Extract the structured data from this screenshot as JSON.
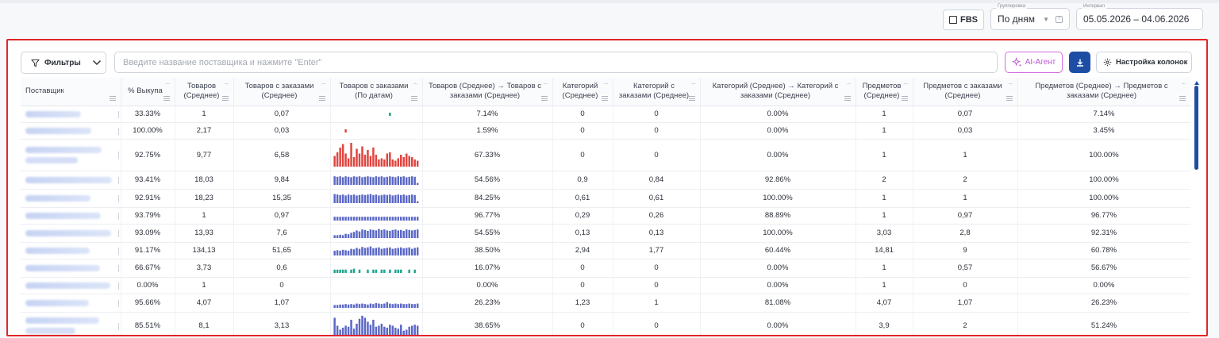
{
  "top": {
    "fbs_label": "FBS",
    "grouping": {
      "caption": "Группировка",
      "value": "По дням"
    },
    "interval": {
      "caption": "Интервал",
      "value": "05.05.2026 – 04.06.2026"
    }
  },
  "toolbar": {
    "filters_label": "Фильтры",
    "search_placeholder": "Введите название поставщика и нажмите \"Enter\"",
    "ai_label": "AI-Агент",
    "columns_label": "Настройка колонок"
  },
  "table": {
    "columns": [
      "Поставщик",
      "% Выкупа",
      "Товаров (Среднее)",
      "Товаров с заказами (Среднее)",
      "Товаров с заказами (По датам)",
      "Товаров (Среднее) → Товаров с заказами (Среднее)",
      "Категорий (Среднее)",
      "Категорий с заказами (Среднее)",
      "Категорий (Среднее) → Категорий с заказами (Среднее)",
      "Предметов (Среднее)",
      "Предметов с заказами (Среднее)",
      "Предметов (Среднее) → Предметов с заказами (Среднее)"
    ],
    "rows": [
      {
        "pct": "33.33%",
        "goods": "1",
        "goods_orders": "0,07",
        "spark": {
          "type": "dots",
          "color": "#1aa58c",
          "values": [
            0,
            0,
            0,
            0,
            0,
            0,
            0,
            0,
            0,
            0,
            0,
            0,
            0,
            0,
            0,
            0,
            0,
            0,
            0,
            0,
            1,
            0,
            0,
            0,
            0,
            0,
            0,
            0,
            0,
            0,
            0
          ]
        },
        "conv": "7.14%",
        "cats": "0",
        "cats_orders": "0",
        "cats_conv": "0.00%",
        "items": "1",
        "items_orders": "0,07",
        "items_conv": "7.14%"
      },
      {
        "pct": "100.00%",
        "goods": "2,17",
        "goods_orders": "0,03",
        "spark": {
          "type": "dots",
          "color": "#e0453f",
          "values": [
            0,
            0,
            0,
            0,
            1,
            0,
            0,
            0,
            0,
            0,
            0,
            0,
            0,
            0,
            0,
            0,
            0,
            0,
            0,
            0,
            0,
            0,
            0,
            0,
            0,
            0,
            0,
            0,
            0,
            0,
            0
          ]
        },
        "conv": "1.59%",
        "cats": "0",
        "cats_orders": "0",
        "cats_conv": "0.00%",
        "items": "1",
        "items_orders": "0,03",
        "items_conv": "3.45%"
      },
      {
        "pct": "92.75%",
        "goods": "9,77",
        "goods_orders": "6,58",
        "spark": {
          "type": "bars",
          "color": "#e0453f",
          "values": [
            0.45,
            0.6,
            0.8,
            0.95,
            0.55,
            0.35,
            1.0,
            0.4,
            0.75,
            0.55,
            0.85,
            0.5,
            0.7,
            0.45,
            0.8,
            0.5,
            0.3,
            0.35,
            0.3,
            0.55,
            0.6,
            0.3,
            0.25,
            0.35,
            0.5,
            0.4,
            0.55,
            0.45,
            0.4,
            0.3,
            0.25
          ]
        },
        "conv": "67.33%",
        "cats": "0",
        "cats_orders": "0",
        "cats_conv": "0.00%",
        "items": "1",
        "items_orders": "1",
        "items_conv": "100.00%"
      },
      {
        "pct": "93.41%",
        "goods": "18,03",
        "goods_orders": "9,84",
        "spark": {
          "type": "bars",
          "color": "#5b68c6",
          "values": [
            0.9,
            0.85,
            0.9,
            0.8,
            0.9,
            0.85,
            0.8,
            0.9,
            0.85,
            0.9,
            0.8,
            0.85,
            0.9,
            0.85,
            0.8,
            0.9,
            0.85,
            0.9,
            0.8,
            0.85,
            0.9,
            0.85,
            0.8,
            0.9,
            0.85,
            0.9,
            0.8,
            0.85,
            0.9,
            0.85,
            0.2
          ]
        },
        "conv": "54.56%",
        "cats": "0,9",
        "cats_orders": "0,84",
        "cats_conv": "92.86%",
        "items": "2",
        "items_orders": "2",
        "items_conv": "100.00%"
      },
      {
        "pct": "92.91%",
        "goods": "18,23",
        "goods_orders": "15,35",
        "spark": {
          "type": "bars",
          "color": "#5b68c6",
          "values": [
            0.95,
            0.9,
            0.85,
            0.9,
            0.8,
            0.9,
            0.85,
            0.9,
            0.8,
            0.85,
            0.9,
            0.85,
            0.9,
            0.95,
            0.85,
            0.9,
            0.8,
            0.85,
            0.9,
            0.85,
            0.9,
            0.8,
            0.85,
            0.9,
            0.85,
            0.9,
            0.8,
            0.85,
            0.9,
            0.85,
            0.2
          ]
        },
        "conv": "84.25%",
        "cats": "0,61",
        "cats_orders": "0,61",
        "cats_conv": "100.00%",
        "items": "1",
        "items_orders": "1",
        "items_conv": "100.00%"
      },
      {
        "pct": "93.79%",
        "goods": "1",
        "goods_orders": "0,97",
        "spark": {
          "type": "bars",
          "color": "#5b68c6",
          "values": [
            0.4,
            0.4,
            0.4,
            0.4,
            0.4,
            0.4,
            0.4,
            0.4,
            0.4,
            0.4,
            0.4,
            0.4,
            0.4,
            0.4,
            0.4,
            0.4,
            0.4,
            0.4,
            0.4,
            0.4,
            0.4,
            0.4,
            0.4,
            0.4,
            0.4,
            0.4,
            0.4,
            0.4,
            0.4,
            0.4,
            0.4
          ]
        },
        "conv": "96.77%",
        "cats": "0,29",
        "cats_orders": "0,26",
        "cats_conv": "88.89%",
        "items": "1",
        "items_orders": "0,97",
        "items_conv": "96.77%"
      },
      {
        "pct": "93.09%",
        "goods": "13,93",
        "goods_orders": "7,6",
        "spark": {
          "type": "bars",
          "color": "#5b68c6",
          "values": [
            0.3,
            0.3,
            0.35,
            0.3,
            0.45,
            0.4,
            0.55,
            0.65,
            0.8,
            0.7,
            0.9,
            0.85,
            0.75,
            0.9,
            0.85,
            0.8,
            0.95,
            0.85,
            0.9,
            0.8,
            0.75,
            0.85,
            0.9,
            0.8,
            0.85,
            0.75,
            0.9,
            0.85,
            0.8,
            0.85,
            0.9
          ]
        },
        "conv": "54.55%",
        "cats": "0,13",
        "cats_orders": "0,13",
        "cats_conv": "100.00%",
        "items": "3,03",
        "items_orders": "2,8",
        "items_conv": "92.31%"
      },
      {
        "pct": "91.17%",
        "goods": "134,13",
        "goods_orders": "51,65",
        "spark": {
          "type": "bars",
          "color": "#5b68c6",
          "values": [
            0.5,
            0.55,
            0.5,
            0.6,
            0.55,
            0.5,
            0.7,
            0.65,
            0.8,
            0.7,
            0.9,
            0.8,
            0.85,
            0.95,
            0.75,
            0.8,
            0.85,
            0.7,
            0.75,
            0.8,
            0.85,
            0.7,
            0.75,
            0.8,
            0.85,
            0.75,
            0.8,
            0.85,
            0.7,
            0.8,
            0.85
          ]
        },
        "conv": "38.50%",
        "cats": "2,94",
        "cats_orders": "1,77",
        "cats_conv": "60.44%",
        "items": "14,81",
        "items_orders": "9",
        "items_conv": "60.78%"
      },
      {
        "pct": "66.67%",
        "goods": "3,73",
        "goods_orders": "0,6",
        "spark": {
          "type": "bars",
          "color": "#1aa58c",
          "values": [
            0.35,
            0.35,
            0.35,
            0.35,
            0.35,
            0,
            0.35,
            0.45,
            0,
            0.35,
            0,
            0,
            0.35,
            0,
            0.35,
            0.35,
            0,
            0.35,
            0.35,
            0,
            0.35,
            0,
            0.35,
            0.35,
            0.35,
            0,
            0,
            0.35,
            0,
            0.35,
            0
          ]
        },
        "conv": "16.07%",
        "cats": "0",
        "cats_orders": "0",
        "cats_conv": "0.00%",
        "items": "1",
        "items_orders": "0,57",
        "items_conv": "56.67%"
      },
      {
        "pct": "0.00%",
        "goods": "1",
        "goods_orders": "0",
        "spark": {
          "type": "none",
          "color": "#5b68c6",
          "values": []
        },
        "conv": "0.00%",
        "cats": "0",
        "cats_orders": "0",
        "cats_conv": "0.00%",
        "items": "1",
        "items_orders": "0",
        "items_conv": "0.00%"
      },
      {
        "pct": "95.66%",
        "goods": "4,07",
        "goods_orders": "1,07",
        "spark": {
          "type": "bars",
          "color": "#5b68c6",
          "values": [
            0.3,
            0.3,
            0.35,
            0.35,
            0.4,
            0.35,
            0.4,
            0.35,
            0.45,
            0.4,
            0.45,
            0.4,
            0.35,
            0.45,
            0.4,
            0.5,
            0.45,
            0.4,
            0.45,
            0.6,
            0.45,
            0.4,
            0.45,
            0.4,
            0.45,
            0.4,
            0.4,
            0.45,
            0.4,
            0.4,
            0.45
          ]
        },
        "conv": "26.23%",
        "cats": "1,23",
        "cats_orders": "1",
        "cats_conv": "81.08%",
        "items": "4,07",
        "items_orders": "1,07",
        "items_conv": "26.23%"
      },
      {
        "pct": "85.51%",
        "goods": "8,1",
        "goods_orders": "3,13",
        "spark": {
          "type": "bars",
          "color": "#5b68c6",
          "values": [
            0.9,
            0.5,
            0.3,
            0.4,
            0.5,
            0.45,
            0.8,
            0.35,
            0.6,
            0.85,
            1.0,
            0.9,
            0.7,
            0.55,
            0.8,
            0.45,
            0.5,
            0.6,
            0.45,
            0.4,
            0.55,
            0.5,
            0.4,
            0.35,
            0.55,
            0.25,
            0.3,
            0.45,
            0.5,
            0.55,
            0.5
          ]
        },
        "conv": "38.65%",
        "cats": "0",
        "cats_orders": "0",
        "cats_conv": "0.00%",
        "items": "3,9",
        "items_orders": "2",
        "items_conv": "51.24%"
      }
    ]
  }
}
